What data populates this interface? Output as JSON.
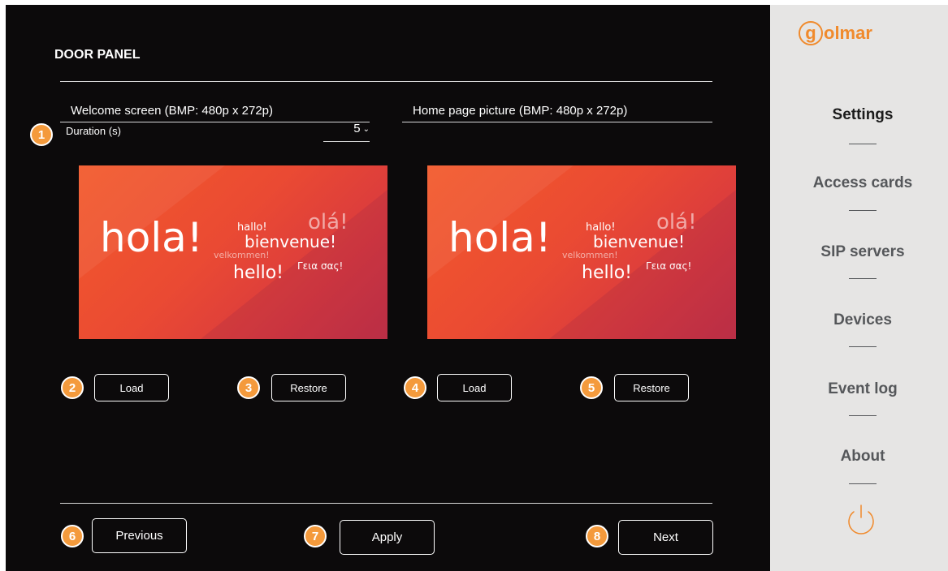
{
  "page": {
    "title": "DOOR PANEL"
  },
  "welcome": {
    "label": "Welcome screen (BMP: 480p x 272p)",
    "duration_label": "Duration (s)",
    "duration_value": "5",
    "load_label": "Load",
    "restore_label": "Restore"
  },
  "home": {
    "label": "Home page picture (BMP: 480p x 272p)",
    "load_label": "Load",
    "restore_label": "Restore"
  },
  "preview": {
    "hola": "hola!",
    "hallo": "hallo!",
    "ola": "olá!",
    "bienvenue": "bienvenue!",
    "velkommen": "velkommen!",
    "hello": "hello!",
    "greek": "Γεια σας!"
  },
  "callouts": [
    "1",
    "2",
    "3",
    "4",
    "5",
    "6",
    "7",
    "8"
  ],
  "footer": {
    "previous_label": "Previous",
    "apply_label": "Apply",
    "next_label": "Next"
  },
  "sidebar": {
    "logo_initial": "g",
    "logo_text": "olmar",
    "items": [
      {
        "label": "Settings",
        "active": true
      },
      {
        "label": "Access cards",
        "active": false
      },
      {
        "label": "SIP servers",
        "active": false
      },
      {
        "label": "Devices",
        "active": false
      },
      {
        "label": "Event log",
        "active": false
      },
      {
        "label": "About",
        "active": false
      }
    ],
    "power_icon": "power-icon"
  },
  "colors": {
    "accent": "#f49a3c",
    "logo": "#f08a2c",
    "main_bg": "#0c0a0b",
    "sidebar_bg": "#e6e5e4"
  }
}
